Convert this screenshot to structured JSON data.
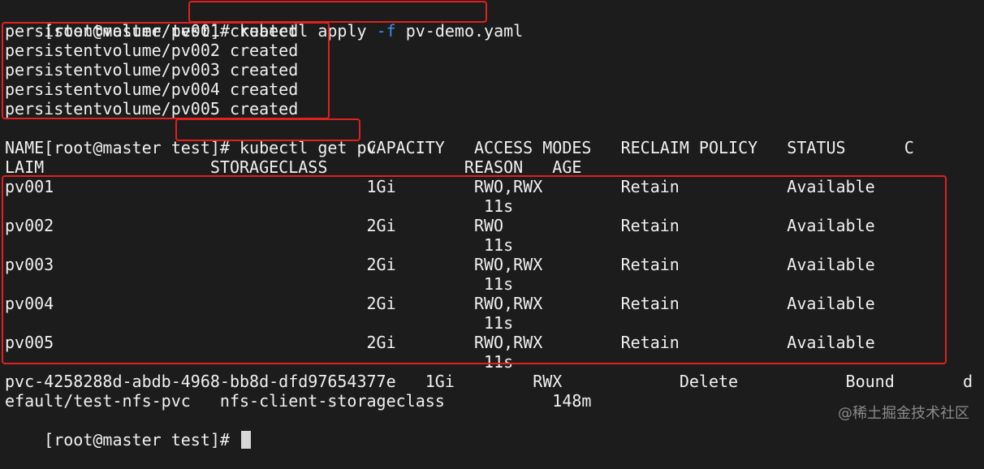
{
  "terminal": {
    "apply": {
      "prompt": "[root@master test]# ",
      "cmd_before_flag": "kubectl apply ",
      "flag": "-f",
      "cmd_after_flag": " pv-demo.yaml"
    },
    "created": [
      "persistentvolume/pv001 created",
      "persistentvolume/pv002 created",
      "persistentvolume/pv003 created",
      "persistentvolume/pv004 created",
      "persistentvolume/pv005 created"
    ],
    "get": {
      "prompt": "[root@master test]",
      "command": "# kubectl get pv"
    },
    "header": {
      "line1": "NAME                                 CAPACITY   ACCESS MODES   RECLAIM POLICY   STATUS      C",
      "line2": "LAIM                 STORAGECLASS              REASON   AGE"
    },
    "pv_rows": [
      {
        "main": "pv001                                1Gi        RWO,RWX        Retain           Available",
        "age": "                                                 11s"
      },
      {
        "main": "pv002                                2Gi        RWO            Retain           Available",
        "age": "                                                 11s"
      },
      {
        "main": "pv003                                2Gi        RWO,RWX        Retain           Available",
        "age": "                                                 11s"
      },
      {
        "main": "pv004                                2Gi        RWO,RWX        Retain           Available",
        "age": "                                                 11s"
      },
      {
        "main": "pv005                                2Gi        RWO,RWX        Retain           Available",
        "age": "                                                 11s"
      }
    ],
    "pvc_row": {
      "main": "pvc-4258288d-abdb-4968-bb8d-dfd97654377e   1Gi        RWX            Delete           Bound       d",
      "cont": "efault/test-nfs-pvc   nfs-client-storageclass           148m"
    },
    "final_prompt": "[root@master test]# "
  },
  "watermark": "@稀土掘金技术社区"
}
